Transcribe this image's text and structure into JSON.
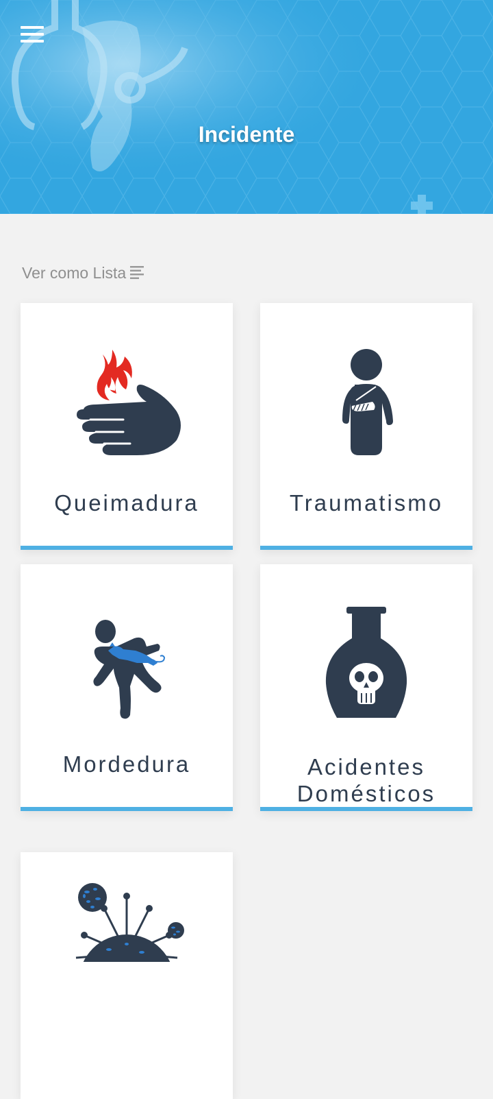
{
  "header": {
    "title": "Incidente",
    "menu_icon": "hamburger-menu-icon"
  },
  "view_toggle": {
    "label": "Ver como Lista",
    "icon": "list-lines-icon"
  },
  "cards": [
    {
      "label": "Queimadura",
      "icon": "burned-hand-icon"
    },
    {
      "label": "Traumatismo",
      "icon": "arm-sling-person-icon"
    },
    {
      "label": "Mordedura",
      "icon": "animal-bite-icon"
    },
    {
      "label_line1": "Acidentes",
      "label_line2": "Domésticos",
      "icon": "poison-bottle-icon"
    },
    {
      "label": "",
      "icon": "virus-bacteria-icon"
    }
  ],
  "colors": {
    "header_blue": "#33a6e0",
    "card_accent": "#4fb0e3",
    "icon_dark": "#2f3d4f",
    "flame_red": "#e32a22",
    "cat_blue": "#2f7fd1"
  }
}
